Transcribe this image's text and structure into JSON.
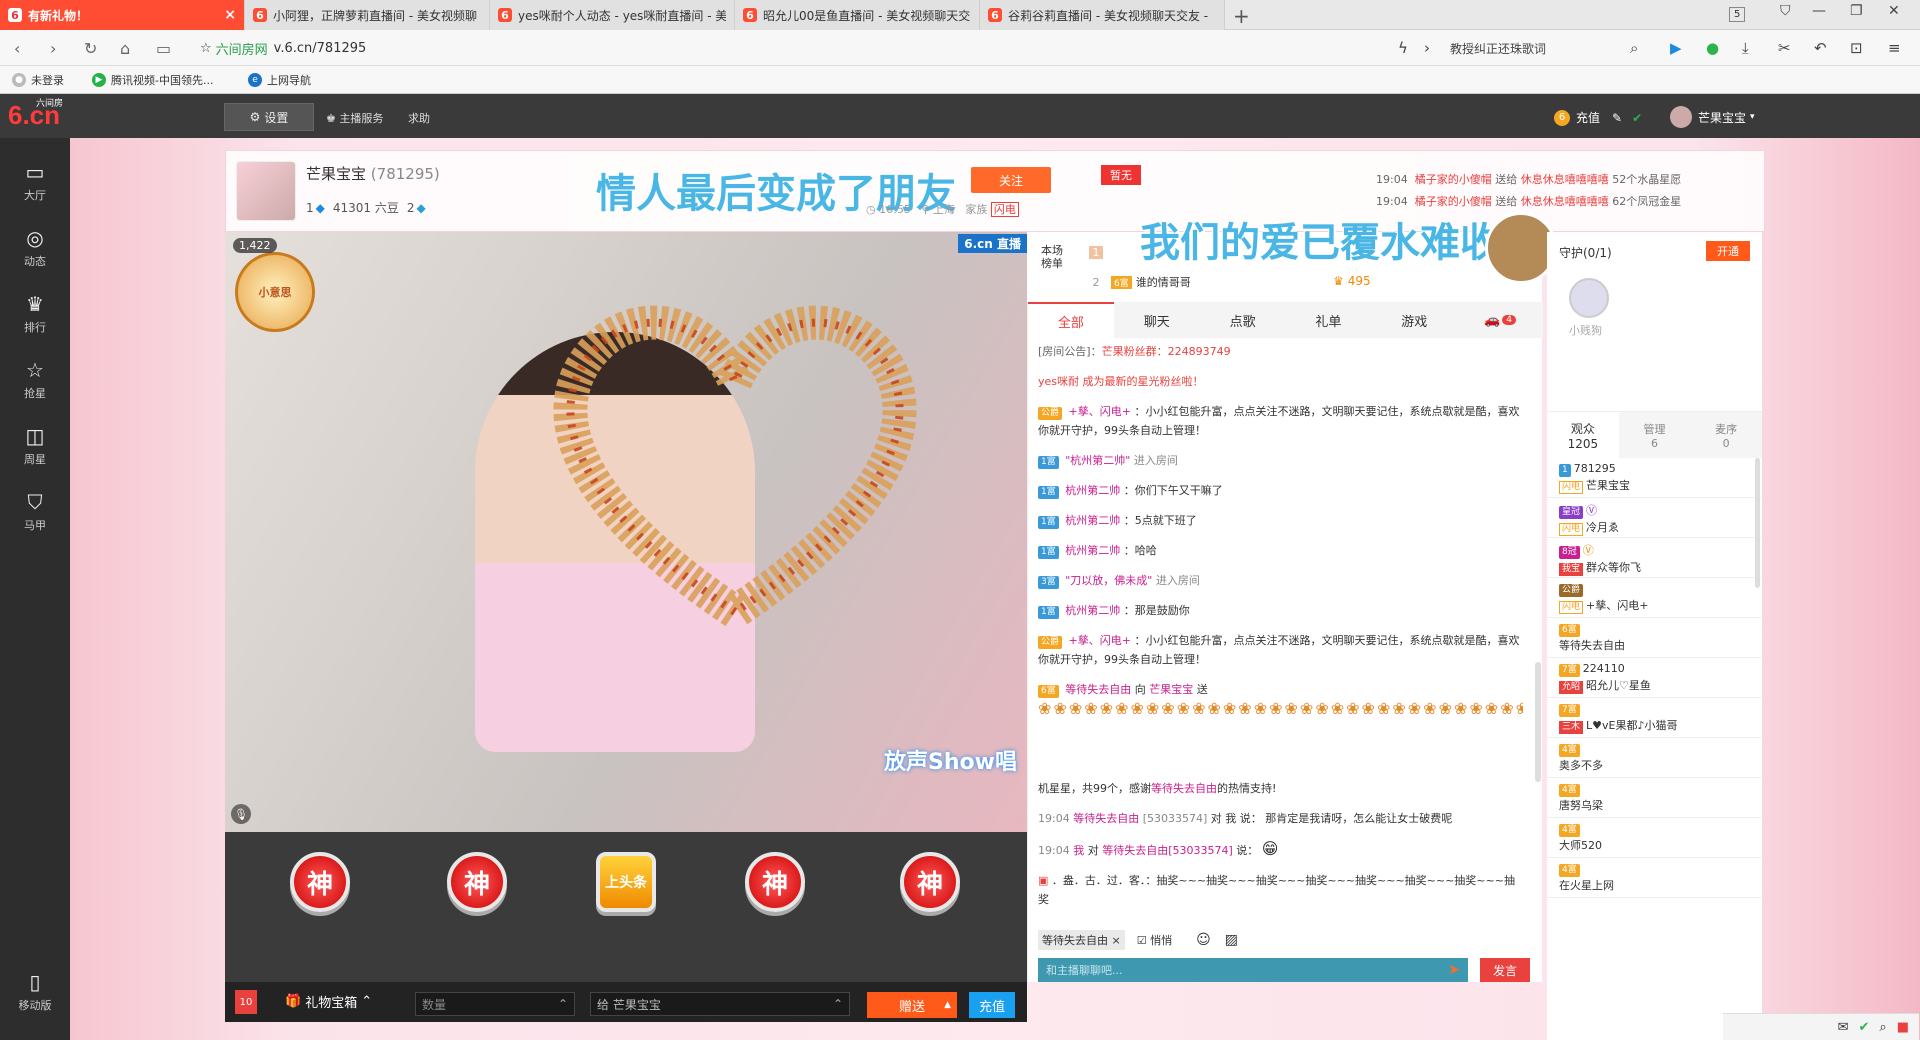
{
  "browser": {
    "tabs": [
      {
        "label": "有新礼物！",
        "active": true
      },
      {
        "label": "小阿狸，正牌萝莉直播间 - 美女视频聊"
      },
      {
        "label": "yes咪耐个人动态 - yes咪耐直播间 - 美"
      },
      {
        "label": "昭允儿00是鱼直播间 - 美女视频聊天交"
      },
      {
        "label": "谷莉谷莉直播间 - 美女视频聊天交友 -"
      }
    ],
    "new_tab": "+",
    "window_count": "5",
    "url_site": "六间房网",
    "url": "v.6.cn/781295",
    "search_text": "教授纠正还珠歌词",
    "bookmarks": [
      {
        "label": "未登录"
      },
      {
        "label": "腾讯视频-中国领先..."
      },
      {
        "label": "上网导航"
      }
    ]
  },
  "site": {
    "logo": "6.cn",
    "logo_small": "六间房",
    "settings_label": "设置",
    "host_service": "主播服务",
    "help": "求助",
    "recharge": "充值",
    "user_name": "芒果宝宝"
  },
  "left_nav": [
    {
      "label": "大厅"
    },
    {
      "label": "动态"
    },
    {
      "label": "排行"
    },
    {
      "label": "抢星"
    },
    {
      "label": "周星"
    },
    {
      "label": "马甲"
    }
  ],
  "mobile_label": "移动版",
  "header": {
    "anchor_name": "芒果宝宝",
    "anchor_id": "(781295)",
    "level": "1",
    "beans": "41301 六豆",
    "level2": "2",
    "follow": "关注",
    "song_title": "情人最后变成了朋友",
    "time": "16:55",
    "location": "上海",
    "family": "家族",
    "flash": "闪电",
    "flag": "暂无",
    "gift_lines": [
      {
        "time": "19:04",
        "from": "橘子家的小傻帽",
        "verb": "送给",
        "to": "休息休息嘻嘻嘻嘻",
        "gift": "52个水晶星愿"
      },
      {
        "time": "19:04",
        "from": "橘子家的小傻帽",
        "verb": "送给",
        "to": "休息休息嘻嘻嘻嘻",
        "gift": "62个凤冠金星"
      }
    ]
  },
  "video": {
    "viewers": "1,422",
    "brand": "6.cn 直播",
    "show": "放声Show唱",
    "medal": "小意思"
  },
  "gift_row": [
    {
      "label": "神"
    },
    {
      "label": "神"
    },
    {
      "label": "上头条"
    },
    {
      "label": "神"
    },
    {
      "label": "神"
    }
  ],
  "bottom": {
    "badge": "10",
    "giftbox": "礼物宝箱",
    "qty_placeholder": "数量",
    "to": "给 芒果宝宝",
    "send": "赠送",
    "recharge": "充值"
  },
  "rank": {
    "label": "本场榜单",
    "rows": [
      {
        "rank": "1",
        "name": ""
      },
      {
        "rank": "2",
        "name": "谁的情哥哥",
        "value": "495"
      }
    ],
    "lyric2": "我们的爱已覆水难收"
  },
  "chat": {
    "tabs": [
      "全部",
      "聊天",
      "点歌",
      "礼单",
      "游戏"
    ],
    "car_badge": "4",
    "notice_label": "[房间公告]：",
    "notice_text": "芒果粉丝群：224893749",
    "messages": [
      {
        "name": "yes咪耐",
        "text": "成为最新的星光粉丝啦！"
      },
      {
        "name": "+孳、闪电+",
        "text": "：小小红包能升富，点点关注不迷路，文明聊天要记住，系统点歇就是酷，喜欢你就开守护，99头条自动上管理！"
      },
      {
        "name": "\"杭州第二帅\"",
        "text": "进入房间"
      },
      {
        "name": "杭州第二帅",
        "text": "：你们下午又干嘛了"
      },
      {
        "name": "杭州第二帅",
        "text": "：5点就下班了"
      },
      {
        "name": "杭州第二帅",
        "text": "：哈哈"
      },
      {
        "name": "\"刀以放，佛未成\"",
        "text": "进入房间"
      },
      {
        "name": "杭州第二帅",
        "text": "：那是鼓励你"
      },
      {
        "name": "+孳、闪电+",
        "text": "：小小红包能升富，点点关注不迷路，文明聊天要记住，系统点歇就是酷，喜欢你就开守护，99头条自动上管理！"
      },
      {
        "name": "等待失去自由",
        "verb": "向",
        "to": "芒果宝宝",
        "text": "送",
        "tail": "机星星，共99个，感谢",
        "tail_name": "等待失去自由",
        "tail_end": "的热情支持!"
      },
      {
        "time": "19:04",
        "name": "等待失去自由",
        "id": "[53033574]",
        "verb": "对 我 说：",
        "text": "那肯定是我请呀，怎么能让女士破费呢"
      },
      {
        "time": "19:04",
        "name": "我",
        "verb": "对",
        "to": "等待失去自由[53033574]",
        "text": "说："
      },
      {
        "text": "．盎．古．过．客．：抽奖~~~抽奖~~~抽奖~~~抽奖~~~抽奖~~~抽奖~~~抽奖~~~抽奖"
      }
    ],
    "target": "等待失去自由",
    "quiet": "悄悄",
    "input_placeholder": "和主播聊聊吧...",
    "send": "发言"
  },
  "right": {
    "guard_title": "守护(0/1)",
    "open": "开通",
    "guard_name": "小贱狗",
    "tabs": [
      {
        "label": "观众",
        "count": "1205"
      },
      {
        "label": "管理",
        "count": "6"
      },
      {
        "label": "麦序",
        "count": "0"
      }
    ],
    "audience": [
      {
        "lv": "1",
        "id": "781295",
        "tag": "闪电",
        "name": "芒果宝宝"
      },
      {
        "lv": "皇冠",
        "tag": "闪电",
        "name": "冷月ゑ"
      },
      {
        "lv": "8冠",
        "tag": "我宝",
        "name": "群众等你飞"
      },
      {
        "lv": "公爵",
        "tag": "闪电",
        "name": "+孳、闪电+"
      },
      {
        "lv": "6富",
        "name": "等待失去自由"
      },
      {
        "lv": "7富",
        "id": "224110",
        "tag": "允昭",
        "name": "昭允儿♡星鱼"
      },
      {
        "lv": "7富",
        "tag": "三木",
        "name": "L♥vE果都♪小猫哥"
      },
      {
        "lv": "4富",
        "name": "奥多不多"
      },
      {
        "lv": "4富",
        "name": "唐努乌梁"
      },
      {
        "lv": "4富",
        "name": "大师520"
      },
      {
        "lv": "4富",
        "name": "在火星上网"
      }
    ]
  }
}
